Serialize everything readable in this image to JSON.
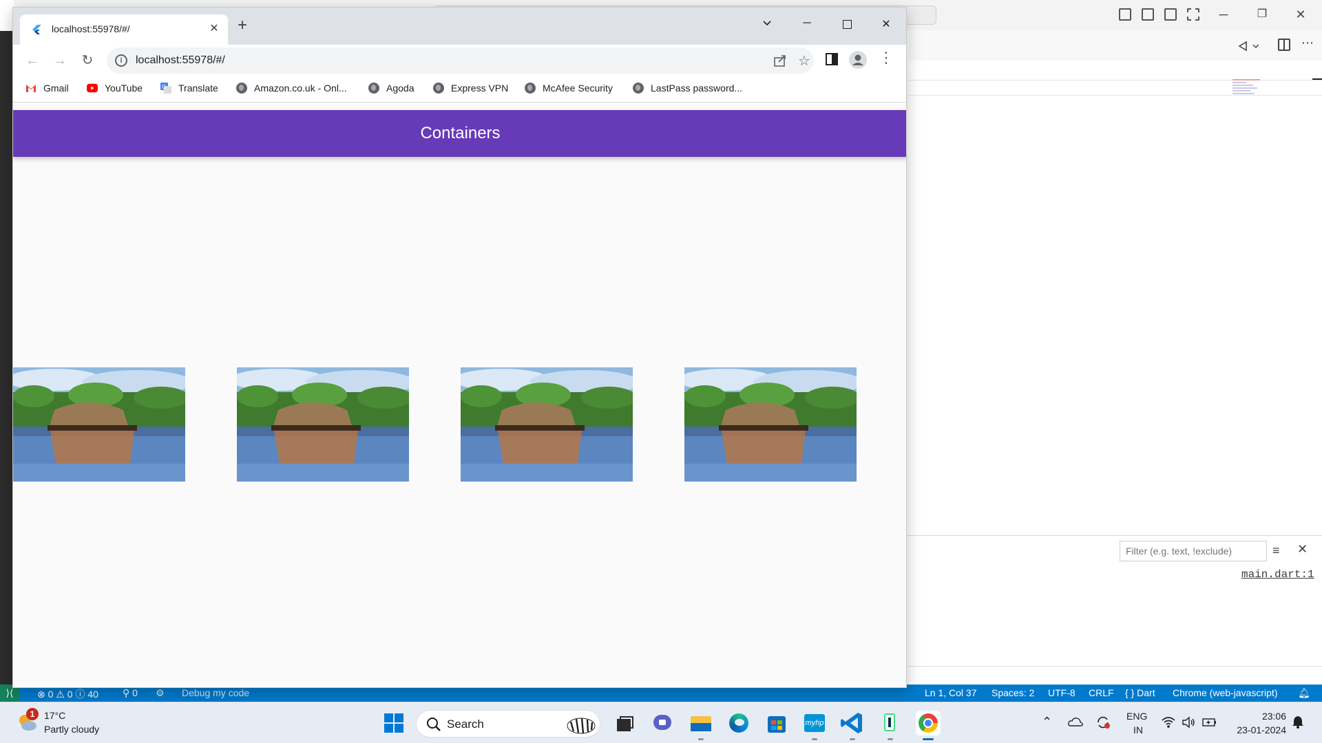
{
  "vscode": {
    "filter_placeholder": "Filter (e.g. text, !exclude)",
    "output_link": "main.dart:1",
    "status": {
      "problems": "⊗ 0 ⚠ 0 ⓘ 40",
      "ports": "⚲ 0",
      "debug": "Debug my code",
      "cursor": "Ln 1, Col 37",
      "spaces": "Spaces: 2",
      "encoding": "UTF-8",
      "eol": "CRLF",
      "language": "{ } Dart",
      "device": "Chrome (web-javascript)"
    }
  },
  "chrome": {
    "tab_title": "localhost:55978/#/",
    "url": "localhost:55978/#/",
    "bookmarks": [
      {
        "label": "Gmail",
        "icon": "gmail-icon"
      },
      {
        "label": "YouTube",
        "icon": "youtube-icon"
      },
      {
        "label": "Translate",
        "icon": "translate-icon"
      },
      {
        "label": "Amazon.co.uk - Onl...",
        "icon": "globe-icon"
      },
      {
        "label": "Agoda",
        "icon": "globe-icon"
      },
      {
        "label": "Express VPN",
        "icon": "globe-icon"
      },
      {
        "label": "McAfee Security",
        "icon": "globe-icon"
      },
      {
        "label": "LastPass password...",
        "icon": "globe-icon"
      }
    ]
  },
  "app": {
    "title": "Containers",
    "accent": "#673ab7",
    "images": [
      {
        "name": "houseboat-image-1"
      },
      {
        "name": "houseboat-image-2"
      },
      {
        "name": "houseboat-image-3"
      },
      {
        "name": "houseboat-image-4"
      }
    ]
  },
  "taskbar": {
    "weather": {
      "badge": "1",
      "temp": "17°C",
      "desc": "Partly cloudy"
    },
    "search_label": "Search",
    "lang_line1": "ENG",
    "lang_line2": "IN",
    "time": "23:06",
    "date": "23-01-2024"
  }
}
